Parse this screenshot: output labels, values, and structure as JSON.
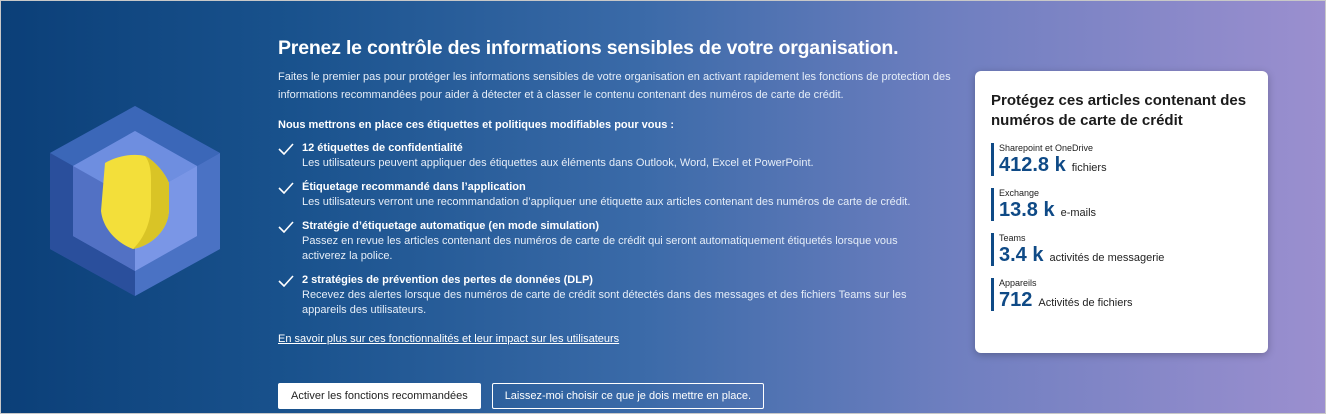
{
  "banner": {
    "title": "Prenez le contrôle des informations sensibles de votre organisation.",
    "intro": "Faites le premier pas pour protéger les informations sensibles de votre organisation en activant rapidement les fonctions de protection des informations recommandées pour aider à détecter et à classer le contenu contenant des numéros de carte de crédit.",
    "subheading": "Nous mettrons en place ces étiquettes et politiques modifiables pour vous :",
    "features": [
      {
        "title": "12 étiquettes de confidentialité",
        "desc": "Les utilisateurs peuvent appliquer des étiquettes aux éléments dans Outlook, Word, Excel et PowerPoint."
      },
      {
        "title": "Étiquetage recommandé dans l’application",
        "desc": "Les utilisateurs verront une recommandation d’appliquer une étiquette aux articles contenant des numéros de carte de crédit."
      },
      {
        "title": "Stratégie d’étiquetage automatique (en mode simulation)",
        "desc": "Passez en revue les articles contenant des numéros de carte de crédit qui seront automatiquement étiquetés lorsque vous activerez la police."
      },
      {
        "title": "2 stratégies de prévention des pertes de données (DLP)",
        "desc": "Recevez des alertes lorsque des numéros de carte de crédit sont détectés dans des messages et des fichiers Teams sur les appareils des utilisateurs."
      }
    ],
    "learn_more": "En savoir plus sur ces fonctionnalités et leur impact sur les utilisateurs",
    "primary_button": "Activer les fonctions recommandées",
    "secondary_button": "Laissez-moi choisir ce que je dois mettre en place."
  },
  "card": {
    "title": "Protégez ces articles contenant des numéros de carte de crédit",
    "stats": [
      {
        "label": "Sharepoint et OneDrive",
        "value": "412.8 k",
        "unit": "fichiers"
      },
      {
        "label": "Exchange",
        "value": "13.8 k",
        "unit": "e-mails"
      },
      {
        "label": "Teams",
        "value": "3.4 k",
        "unit": "activités de messagerie"
      },
      {
        "label": "Appareils",
        "value": "712",
        "unit": "Activités de fichiers"
      }
    ]
  },
  "icons": {
    "illustration": "shield-hexagon-icon",
    "check": "checkmark-icon"
  },
  "colors": {
    "gradient_start": "#0b3f78",
    "gradient_end": "#9b8fcf",
    "stat_accent": "#0f4a86",
    "shield": "#f3df3a"
  }
}
